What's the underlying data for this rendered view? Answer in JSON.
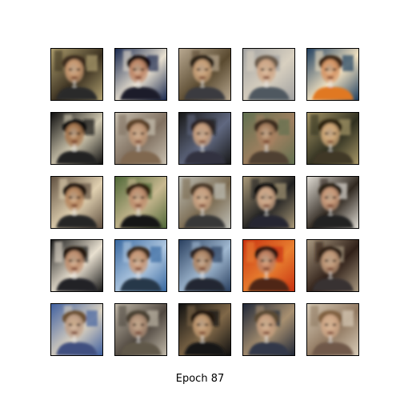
{
  "caption": "Epoch 87",
  "grid": {
    "rows": 5,
    "cols": 5,
    "samples": [
      {
        "bg": "#b0a070",
        "bg2": "#3a3020",
        "skin": "#c89870",
        "hair": "#3a2a1a",
        "cloth": "#2a2a2a"
      },
      {
        "bg": "#1a2a50",
        "bg2": "#e8e0d0",
        "skin": "#c08868",
        "hair": "#151010",
        "cloth": "#1a1a2a"
      },
      {
        "bg": "#b8a890",
        "bg2": "#5a4a30",
        "skin": "#c8a078",
        "hair": "#2a2018",
        "cloth": "#3a3a40"
      },
      {
        "bg": "#a0a0a0",
        "bg2": "#d8d0c0",
        "skin": "#d0a888",
        "hair": "#6a5a4a",
        "cloth": "#505860"
      },
      {
        "bg": "#204060",
        "bg2": "#f0e0c0",
        "skin": "#d89868",
        "hair": "#3a2818",
        "cloth": "#e07820"
      },
      {
        "bg": "#101010",
        "bg2": "#d0c8b0",
        "skin": "#a87850",
        "hair": "#0a0a0a",
        "cloth": "#202020"
      },
      {
        "bg": "#c8c0b0",
        "bg2": "#807060",
        "skin": "#c09878",
        "hair": "#5a4028",
        "cloth": "#806850"
      },
      {
        "bg": "#181818",
        "bg2": "#606880",
        "skin": "#c8a080",
        "hair": "#2a2020",
        "cloth": "#303040"
      },
      {
        "bg": "#607050",
        "bg2": "#a08060",
        "skin": "#a88060",
        "hair": "#3a2a1a",
        "cloth": "#504030"
      },
      {
        "bg": "#a89868",
        "bg2": "#303020",
        "skin": "#d0a878",
        "hair": "#2a2010",
        "cloth": "#403828"
      },
      {
        "bg": "#605040",
        "bg2": "#e0d0b0",
        "skin": "#b88860",
        "hair": "#201810",
        "cloth": "#282828"
      },
      {
        "bg": "#506838",
        "bg2": "#c8b890",
        "skin": "#c09070",
        "hair": "#302010",
        "cloth": "#181818"
      },
      {
        "bg": "#c0c0b8",
        "bg2": "#7a6a50",
        "skin": "#c8a080",
        "hair": "#4a3828",
        "cloth": "#383838"
      },
      {
        "bg": "#a89878",
        "bg2": "#202020",
        "skin": "#d0a888",
        "hair": "#101010",
        "cloth": "#282830"
      },
      {
        "bg": "#e0dcd4",
        "bg2": "#302820",
        "skin": "#c89878",
        "hair": "#2a2018",
        "cloth": "#202020"
      },
      {
        "bg": "#181818",
        "bg2": "#e8e0d0",
        "skin": "#c09070",
        "hair": "#201810",
        "cloth": "#202028"
      },
      {
        "bg": "#3868a0",
        "bg2": "#b0c8e0",
        "skin": "#c89878",
        "hair": "#3a2a1a",
        "cloth": "#283848"
      },
      {
        "bg": "#2a4060",
        "bg2": "#a0b8d0",
        "skin": "#b08868",
        "hair": "#2a2020",
        "cloth": "#202830"
      },
      {
        "bg": "#c83010",
        "bg2": "#e88030",
        "skin": "#c08060",
        "hair": "#301810",
        "cloth": "#502818"
      },
      {
        "bg": "#a89880",
        "bg2": "#302018",
        "skin": "#c09878",
        "hair": "#302018",
        "cloth": "#383030"
      },
      {
        "bg": "#4060a0",
        "bg2": "#d8d0c0",
        "skin": "#c0a088",
        "hair": "#6a5030",
        "cloth": "#405080"
      },
      {
        "bg": "#c0b8a8",
        "bg2": "#504840",
        "skin": "#b09078",
        "hair": "#4a4030",
        "cloth": "#605848"
      },
      {
        "bg": "#101010",
        "bg2": "#806848",
        "skin": "#c09870",
        "hair": "#201810",
        "cloth": "#181818"
      },
      {
        "bg": "#202838",
        "bg2": "#a89070",
        "skin": "#c8a080",
        "hair": "#5a4830",
        "cloth": "#303848"
      },
      {
        "bg": "#d8ccb8",
        "bg2": "#907860",
        "skin": "#d0a888",
        "hair": "#806040",
        "cloth": "#705848"
      }
    ]
  }
}
